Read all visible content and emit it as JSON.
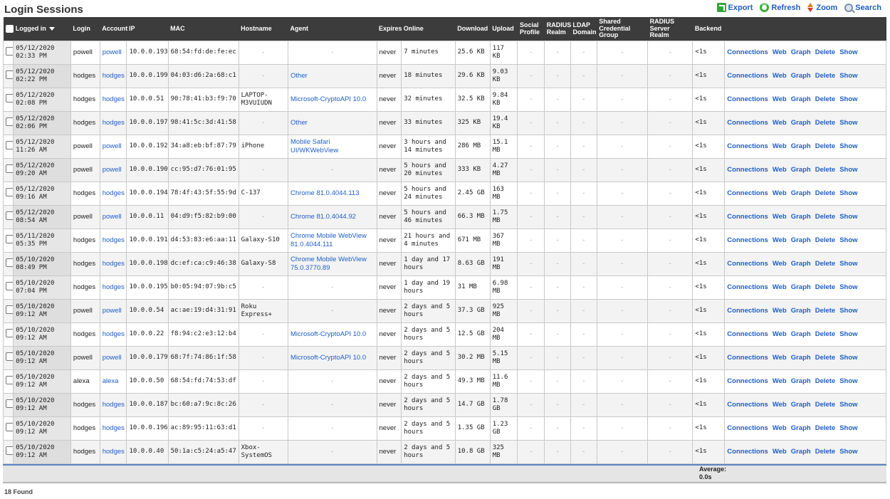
{
  "page": {
    "title": "Login Sessions",
    "found": "18 Found",
    "footer_average": "Average:\n0.0s"
  },
  "actions": [
    {
      "label": "Export",
      "icon": "export-icon"
    },
    {
      "label": "Refresh",
      "icon": "refresh-icon"
    },
    {
      "label": "Zoom",
      "icon": "zoom-icon"
    },
    {
      "label": "Search",
      "icon": "search-icon"
    }
  ],
  "columns": [
    "Logged in",
    "Login",
    "Account",
    "IP",
    "MAC",
    "Hostname",
    "Agent",
    "Expires",
    "Online",
    "Download",
    "Upload",
    "Social Profile",
    "RADIUS Realm",
    "LDAP Domain",
    "Shared Credential Group",
    "RADIUS Server Realm",
    "Backend",
    ""
  ],
  "row_actions": [
    "Connections",
    "Web",
    "Graph",
    "Delete",
    "Show"
  ],
  "rows": [
    {
      "logged_in": "05/12/2020 02:33 PM",
      "login": "powell",
      "account": "powell",
      "ip": "10.0.0.193",
      "mac": "68:54:fd:de:fe:ec",
      "hostname": "-",
      "agent": "-",
      "expires": "never",
      "online": "7 minutes",
      "download": "25.6 KB",
      "upload": "117 KB",
      "backend": "<1s"
    },
    {
      "logged_in": "05/12/2020 02:22 PM",
      "login": "hodges",
      "account": "hodges",
      "ip": "10.0.0.199",
      "mac": "04:03:d6:2a:68:c1",
      "hostname": "-",
      "agent": "Other",
      "expires": "never",
      "online": "18 minutes",
      "download": "29.6 KB",
      "upload": "9.03 KB",
      "backend": "<1s"
    },
    {
      "logged_in": "05/12/2020 02:08 PM",
      "login": "hodges",
      "account": "hodges",
      "ip": "10.0.0.51",
      "mac": "90:78:41:b3:f9:70",
      "hostname": "LAPTOP-M3VUIUDN",
      "agent": "Microsoft-CryptoAPI 10.0",
      "expires": "never",
      "online": "32 minutes",
      "download": "32.5 KB",
      "upload": "9.84 KB",
      "backend": "<1s"
    },
    {
      "logged_in": "05/12/2020 02:06 PM",
      "login": "hodges",
      "account": "hodges",
      "ip": "10.0.0.197",
      "mac": "98:41:5c:3d:41:58",
      "hostname": "-",
      "agent": "Other",
      "expires": "never",
      "online": "33 minutes",
      "download": "325 KB",
      "upload": "19.4 KB",
      "backend": "<1s"
    },
    {
      "logged_in": "05/12/2020 11:26 AM",
      "login": "powell",
      "account": "powell",
      "ip": "10.0.0.192",
      "mac": "34:a8:eb:bf:87:79",
      "hostname": "iPhone",
      "agent": "Mobile Safari UI/WKWebView",
      "expires": "never",
      "online": "3 hours and 14 minutes",
      "download": "286 MB",
      "upload": "15.1 MB",
      "backend": "<1s"
    },
    {
      "logged_in": "05/12/2020 09:20 AM",
      "login": "powell",
      "account": "powell",
      "ip": "10.0.0.190",
      "mac": "cc:95:d7:76:01:95",
      "hostname": "-",
      "agent": "-",
      "expires": "never",
      "online": "5 hours and 20 minutes",
      "download": "333 KB",
      "upload": "4.27 MB",
      "backend": "<1s"
    },
    {
      "logged_in": "05/12/2020 09:16 AM",
      "login": "hodges",
      "account": "hodges",
      "ip": "10.0.0.194",
      "mac": "78:4f:43:5f:55:9d",
      "hostname": "C-137",
      "agent": "Chrome 81.0.4044.113",
      "expires": "never",
      "online": "5 hours and 24 minutes",
      "download": "2.45 GB",
      "upload": "163 MB",
      "backend": "<1s"
    },
    {
      "logged_in": "05/12/2020 08:54 AM",
      "login": "powell",
      "account": "powell",
      "ip": "10.0.0.11",
      "mac": "04:d9:f5:82:b9:00",
      "hostname": "-",
      "agent": "Chrome 81.0.4044.92",
      "expires": "never",
      "online": "5 hours and 46 minutes",
      "download": "66.3 MB",
      "upload": "1.75 MB",
      "backend": "<1s"
    },
    {
      "logged_in": "05/11/2020 05:35 PM",
      "login": "hodges",
      "account": "hodges",
      "ip": "10.0.0.191",
      "mac": "d4:53:83:e6:aa:11",
      "hostname": "Galaxy-S10",
      "agent": "Chrome Mobile WebView 81.0.4044.111",
      "expires": "never",
      "online": "21 hours and 4 minutes",
      "download": "671 MB",
      "upload": "367 MB",
      "backend": "<1s"
    },
    {
      "logged_in": "05/10/2020 08:49 PM",
      "login": "hodges",
      "account": "hodges",
      "ip": "10.0.0.198",
      "mac": "dc:ef:ca:c9:46:38",
      "hostname": "Galaxy-S8",
      "agent": "Chrome Mobile WebView 75.0.3770.89",
      "expires": "never",
      "online": "1 day and 17 hours",
      "download": "8.63 GB",
      "upload": "191 MB",
      "backend": "<1s"
    },
    {
      "logged_in": "05/10/2020 07:04 PM",
      "login": "hodges",
      "account": "hodges",
      "ip": "10.0.0.195",
      "mac": "b0:05:94:07:9b:c5",
      "hostname": "-",
      "agent": "-",
      "expires": "never",
      "online": "1 day and 19 hours",
      "download": "31 MB",
      "upload": "6.98 MB",
      "backend": "<1s"
    },
    {
      "logged_in": "05/10/2020 09:12 AM",
      "login": "powell",
      "account": "powell",
      "ip": "10.0.0.54",
      "mac": "ac:ae:19:d4:31:91",
      "hostname": "Roku Express+",
      "agent": "-",
      "expires": "never",
      "online": "2 days and 5 hours",
      "download": "37.3 GB",
      "upload": "925 MB",
      "backend": "<1s"
    },
    {
      "logged_in": "05/10/2020 09:12 AM",
      "login": "hodges",
      "account": "hodges",
      "ip": "10.0.0.22",
      "mac": "f8:94:c2:e3:12:b4",
      "hostname": "-",
      "agent": "Microsoft-CryptoAPI 10.0",
      "expires": "never",
      "online": "2 days and 5 hours",
      "download": "12.5 GB",
      "upload": "204 MB",
      "backend": "<1s"
    },
    {
      "logged_in": "05/10/2020 09:12 AM",
      "login": "powell",
      "account": "powell",
      "ip": "10.0.0.179",
      "mac": "68:7f:74:86:1f:58",
      "hostname": "-",
      "agent": "Microsoft-CryptoAPI 10.0",
      "expires": "never",
      "online": "2 days and 5 hours",
      "download": "30.2 MB",
      "upload": "5.15 MB",
      "backend": "<1s"
    },
    {
      "logged_in": "05/10/2020 09:12 AM",
      "login": "alexa",
      "account": "alexa",
      "ip": "10.0.0.50",
      "mac": "68:54:fd:74:53:df",
      "hostname": "-",
      "agent": "-",
      "expires": "never",
      "online": "2 days and 5 hours",
      "download": "49.3 MB",
      "upload": "11.6 MB",
      "backend": "<1s"
    },
    {
      "logged_in": "05/10/2020 09:12 AM",
      "login": "hodges",
      "account": "hodges",
      "ip": "10.0.0.187",
      "mac": "bc:60:a7:9c:8c:26",
      "hostname": "-",
      "agent": "-",
      "expires": "never",
      "online": "2 days and 5 hours",
      "download": "14.7 GB",
      "upload": "1.78 GB",
      "backend": "<1s"
    },
    {
      "logged_in": "05/10/2020 09:12 AM",
      "login": "hodges",
      "account": "hodges",
      "ip": "10.0.0.196",
      "mac": "ac:89:95:11:63:d1",
      "hostname": "-",
      "agent": "-",
      "expires": "never",
      "online": "2 days and 5 hours",
      "download": "1.35 GB",
      "upload": "1.23 GB",
      "backend": "<1s"
    },
    {
      "logged_in": "05/10/2020 09:12 AM",
      "login": "hodges",
      "account": "hodges",
      "ip": "10.0.0.40",
      "mac": "50:1a:c5:24:a5:47",
      "hostname": "Xbox-SystemOS",
      "agent": "-",
      "expires": "never",
      "online": "2 days and 5 hours",
      "download": "10.8 GB",
      "upload": "325 MB",
      "backend": "<1s"
    }
  ],
  "empty_cell": "-",
  "colors": {
    "header_bg": "#3c3c3c",
    "link": "#1f5fc4",
    "footer_line": "#5a86c0"
  }
}
